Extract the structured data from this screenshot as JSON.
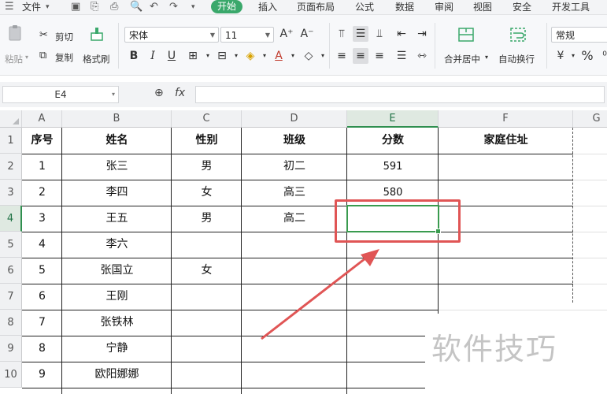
{
  "menubar": {
    "file": "文件",
    "tabs": [
      "开始",
      "插入",
      "页面布局",
      "公式",
      "数据",
      "审阅",
      "视图",
      "安全",
      "开发工具"
    ],
    "active_tab": "开始"
  },
  "ribbon": {
    "paste": "粘贴",
    "cut": "剪切",
    "copy": "复制",
    "format_painter": "格式刷",
    "font_name": "宋体",
    "font_size": "11",
    "merge_center": "合并居中",
    "wrap_text": "自动换行",
    "number_format": "常规",
    "percent": "%"
  },
  "formula_bar": {
    "name_box": "E4",
    "fx": "fx",
    "value": ""
  },
  "sheet": {
    "columns": [
      "A",
      "B",
      "C",
      "D",
      "E",
      "F",
      "G"
    ],
    "rows": [
      "1",
      "2",
      "3",
      "4",
      "5",
      "6",
      "7",
      "8",
      "9",
      "10"
    ],
    "header": [
      "序号",
      "姓名",
      "性别",
      "班级",
      "分数",
      "家庭住址"
    ],
    "data": [
      [
        "1",
        "张三",
        "男",
        "初二",
        "591",
        ""
      ],
      [
        "2",
        "李四",
        "女",
        "高三",
        "580",
        ""
      ],
      [
        "3",
        "王五",
        "男",
        "高二",
        "",
        ""
      ],
      [
        "4",
        "李六",
        "",
        "",
        "",
        ""
      ],
      [
        "5",
        "张国立",
        "女",
        "",
        "",
        ""
      ],
      [
        "6",
        "王刚",
        "",
        "",
        "",
        ""
      ],
      [
        "7",
        "张铁林",
        "",
        "",
        "",
        ""
      ],
      [
        "8",
        "宁静",
        "",
        "",
        "",
        ""
      ],
      [
        "9",
        "欧阳娜娜",
        "",
        "",
        "",
        ""
      ]
    ],
    "active_cell": "E4"
  },
  "watermark": "软件技巧",
  "colors": {
    "accent": "#3aa86b",
    "selection": "#3a9b4f",
    "annotation": "#e05555"
  }
}
